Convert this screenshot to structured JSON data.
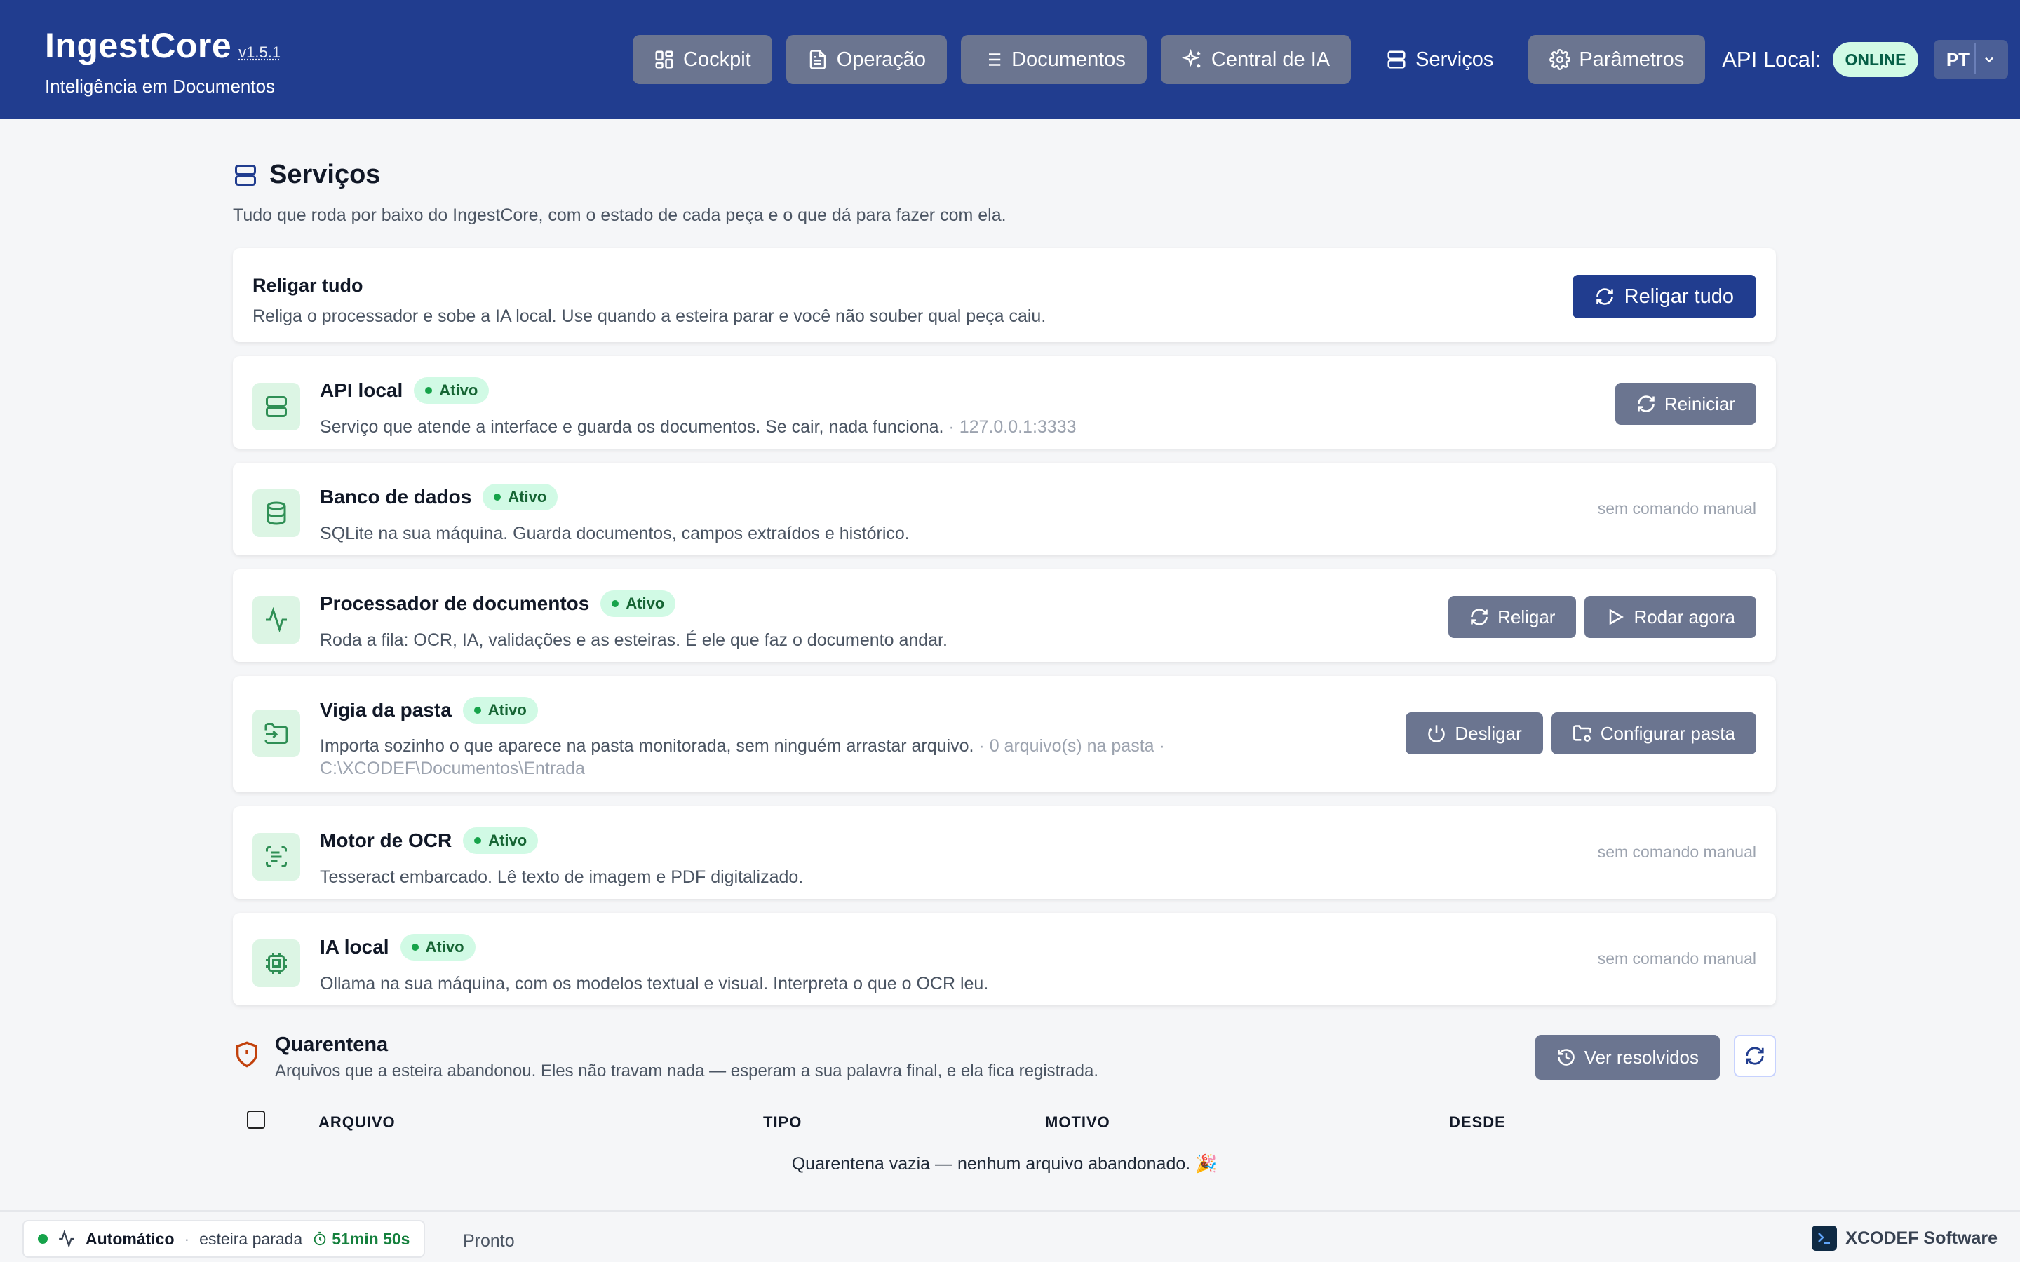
{
  "header": {
    "app_name": "IngestCore",
    "version": "v1.5.1",
    "subtitle": "Inteligência em Documentos",
    "nav": [
      {
        "label": "Cockpit",
        "icon": "dashboard-icon"
      },
      {
        "label": "Operação",
        "icon": "document-icon"
      },
      {
        "label": "Documentos",
        "icon": "list-icon"
      },
      {
        "label": "Central de IA",
        "icon": "sparkles-icon"
      },
      {
        "label": "Serviços",
        "icon": "server-icon"
      },
      {
        "label": "Parâmetros",
        "icon": "gear-icon"
      }
    ],
    "active_nav": "Serviços",
    "api_label": "API Local:",
    "api_status": "ONLINE",
    "language": "PT"
  },
  "page": {
    "title": "Serviços",
    "description": "Tudo que roda por baixo do IngestCore, com o estado de cada peça e o que dá para fazer com ela."
  },
  "restart_all": {
    "title": "Religar tudo",
    "description": "Religa o processador e sobe a IA local. Use quando a esteira parar e você não souber qual peça caiu.",
    "button": "Religar tudo"
  },
  "services": [
    {
      "name": "API local",
      "status": "Ativo",
      "description": "Serviço que atende a interface e guarda os documentos. Se cair, nada funciona.",
      "extra": " · 127.0.0.1:3333",
      "actions": [
        "Reiniciar"
      ],
      "icon": "server-icon"
    },
    {
      "name": "Banco de dados",
      "status": "Ativo",
      "description": "SQLite na sua máquina. Guarda documentos, campos extraídos e histórico.",
      "extra": "",
      "no_manual": "sem comando manual",
      "icon": "database-icon"
    },
    {
      "name": "Processador de documentos",
      "status": "Ativo",
      "description": "Roda a fila: OCR, IA, validações e as esteiras. É ele que faz o documento andar.",
      "extra": "",
      "actions": [
        "Religar",
        "Rodar agora"
      ],
      "icon": "activity-icon"
    },
    {
      "name": "Vigia da pasta",
      "status": "Ativo",
      "description": "Importa sozinho o que aparece na pasta monitorada, sem ninguém arrastar arquivo.",
      "extra": " · 0 arquivo(s) na pasta ·",
      "path": "C:\\XCODEF\\Documentos\\Entrada",
      "actions": [
        "Desligar",
        "Configurar pasta"
      ],
      "icon": "folder-input-icon"
    },
    {
      "name": "Motor de OCR",
      "status": "Ativo",
      "description": "Tesseract embarcado. Lê texto de imagem e PDF digitalizado.",
      "extra": "",
      "no_manual": "sem comando manual",
      "icon": "scan-text-icon"
    },
    {
      "name": "IA local",
      "status": "Ativo",
      "description": "Ollama na sua máquina, com os modelos textual e visual. Interpreta o que o OCR leu.",
      "extra": "",
      "no_manual": "sem comando manual",
      "icon": "cpu-icon"
    }
  ],
  "quarantine": {
    "title": "Quarentena",
    "description": "Arquivos que a esteira abandonou. Eles não travam nada — esperam a sua palavra final, e ela fica registrada.",
    "view_resolved": "Ver resolvidos",
    "columns": [
      "ARQUIVO",
      "TIPO",
      "MOTIVO",
      "DESDE"
    ],
    "empty": "Quarentena vazia — nenhum arquivo abandonado. 🎉"
  },
  "footer": {
    "mode": "Automático",
    "pipeline": "esteira parada",
    "timer": "51min 50s",
    "status": "Pronto",
    "vendor": "XCODEF Software"
  },
  "colors": {
    "header_bg": "#213d8f",
    "accent": "#213d8f",
    "success": "#16a34a",
    "button_gray": "#6b7590"
  }
}
